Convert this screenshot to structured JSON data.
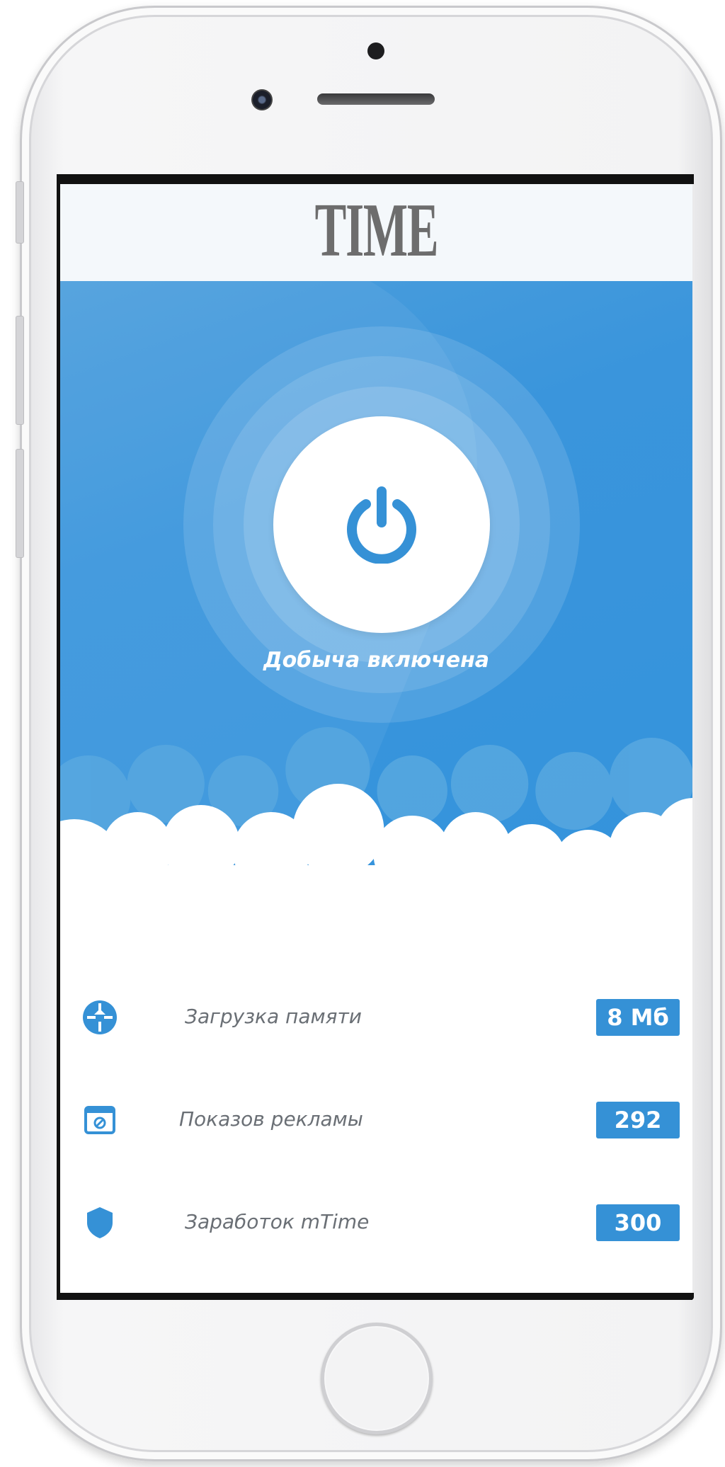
{
  "app": {
    "logo_text": "TIME"
  },
  "hero": {
    "status_text": "Добыча включена",
    "power_icon": "power-icon"
  },
  "stats": [
    {
      "icon": "memory-sync-icon",
      "label": "Загрузка памяти",
      "value": "8 Мб"
    },
    {
      "icon": "ad-screen-icon",
      "label": "Показов рекламы",
      "value": "292"
    },
    {
      "icon": "shield-icon",
      "label": "Заработок mTime",
      "value": "300"
    }
  ],
  "colors": {
    "accent": "#3591d6",
    "hero_background": "#3a95dc",
    "text_muted": "#6a6f75"
  }
}
